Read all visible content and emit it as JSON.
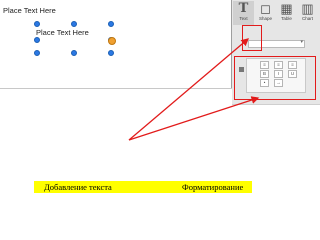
{
  "slide": {
    "top_placeholder": "Place Text Here",
    "selected_textbox_text": "Place Text Here"
  },
  "toolbar": {
    "tools": [
      "Text",
      "Shape",
      "Table",
      "Chart"
    ]
  },
  "captions": {
    "left": "Добавление текста",
    "right": "Форматирование"
  },
  "colors": {
    "annotation": "#e21b1b",
    "caption_highlight": "#ffff00",
    "handle": "#2b78e4"
  }
}
